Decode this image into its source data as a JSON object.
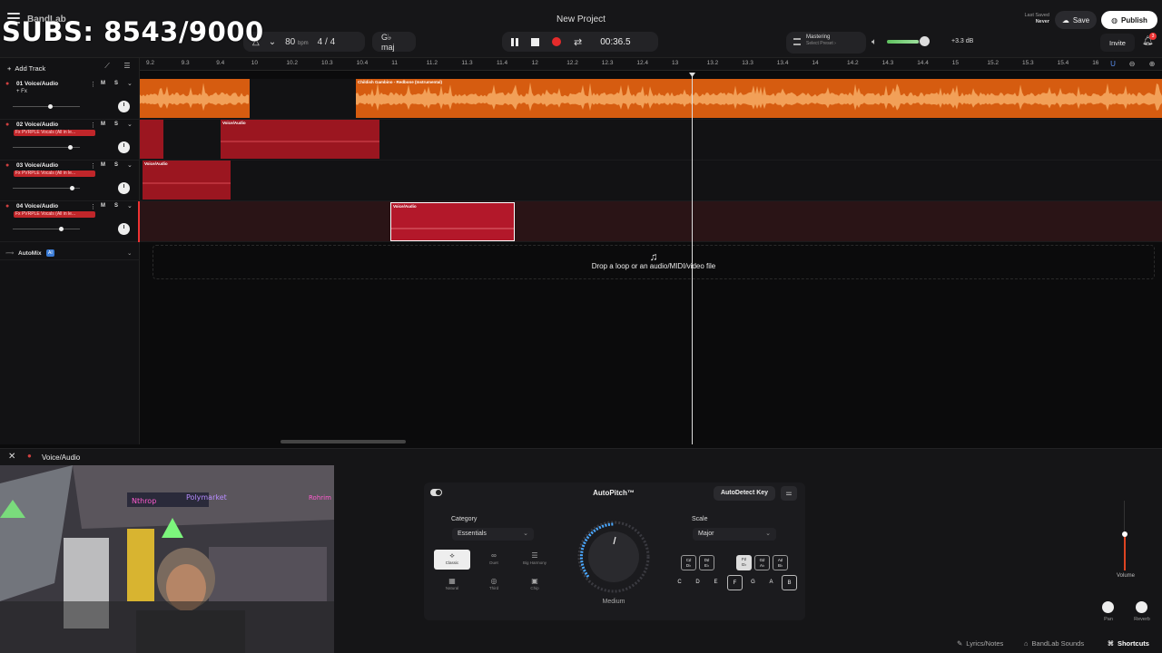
{
  "overlay": {
    "subs": "SUBS: 8543/9000"
  },
  "header": {
    "brand": "BandLab",
    "project_title": "New Project",
    "tempo": "80",
    "tempo_unit": "bpm",
    "time_signature": "4 / 4",
    "key": "G♭ maj",
    "timecode": "00:36.5",
    "mastering_label": "Mastering",
    "mastering_sub": "Select Preset ›",
    "volume_db": "+3.3 dB",
    "volume_level": 0.8,
    "last_saved_label": "Last Saved",
    "last_saved_value": "Never",
    "save_label": "Save",
    "publish_label": "Publish",
    "invite_label": "Invite",
    "notifications": "3"
  },
  "track_panel": {
    "add_track": "Add Track",
    "automix": "AutoMix",
    "automix_badge": "AI",
    "tracks": [
      {
        "name": "01 Voice/Audio",
        "fx": "+ Fx",
        "m": "M",
        "s": "S"
      },
      {
        "name": "02 Voice/Audio",
        "fx": "Fx PVRPLE Vocals (All in le...",
        "m": "M",
        "s": "S"
      },
      {
        "name": "03 Voice/Audio",
        "fx": "Fx PVRPLE Vocals (All in le...",
        "m": "M",
        "s": "S"
      },
      {
        "name": "04 Voice/Audio",
        "fx": "Fx PVRPLE Vocals (All in le...",
        "m": "M",
        "s": "S"
      }
    ]
  },
  "ruler": {
    "ticks": [
      "9.2",
      "9.3",
      "9.4",
      "10",
      "10.2",
      "10.3",
      "10.4",
      "11",
      "11.2",
      "11.3",
      "11.4",
      "12",
      "12.2",
      "12.3",
      "12.4",
      "13",
      "13.2",
      "13.3",
      "13.4",
      "14",
      "14.2",
      "14.3",
      "14.4",
      "15",
      "15.2",
      "15.3",
      "15.4",
      "16"
    ]
  },
  "clips": {
    "track1_main": "Childish Gambino - Redbone (Instrumental)",
    "track2": "Voice/Audio",
    "track3": "Voice/Audio",
    "track4": "Voice/Audio"
  },
  "drop_zone": {
    "text": "Drop a loop or an audio/MIDI/video file"
  },
  "bottom_panel": {
    "title": "Voice/Audio"
  },
  "autopitch": {
    "title": "AutoPitch™",
    "autodetect": "AutoDetect Key",
    "category_label": "Category",
    "category_value": "Essentials",
    "modes": [
      "Classic",
      "Duet",
      "Big Harmony",
      "Natural",
      "Third",
      "Chip"
    ],
    "selected_mode": "Classic",
    "dial_label": "Medium",
    "scale_label": "Scale",
    "scale_value": "Major",
    "black_keys": [
      [
        "C♯",
        "D♭"
      ],
      [
        "D♯",
        "E♭"
      ],
      [
        "F♯",
        "G♭"
      ],
      [
        "G♯",
        "A♭"
      ],
      [
        "A♯",
        "B♭"
      ]
    ],
    "white_keys": [
      "C",
      "D",
      "E",
      "F",
      "G",
      "A",
      "B"
    ]
  },
  "mixer": {
    "volume_label": "Volume",
    "pan_label": "Pan",
    "reverb_label": "Reverb"
  },
  "footer": {
    "lyrics": "Lyrics/Notes",
    "sounds": "BandLab Sounds",
    "shortcuts": "Shortcuts"
  }
}
